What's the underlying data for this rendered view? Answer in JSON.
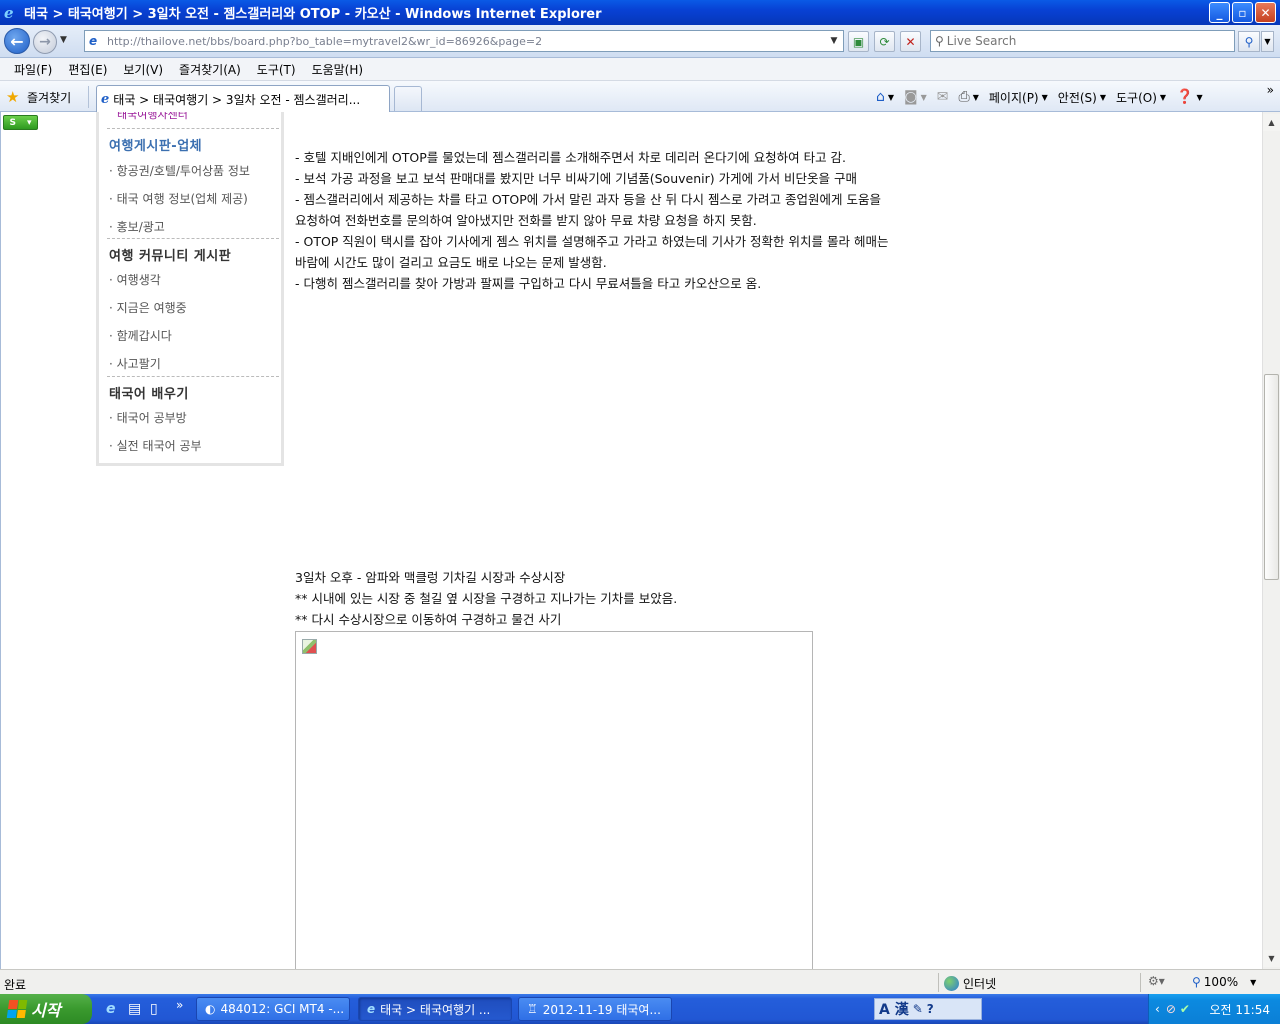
{
  "window": {
    "title": "태국 > 태국여행기 > 3일차 오전 - 젬스갤러리와 OTOP - 카오산 - Windows Internet Explorer",
    "logo_glyph": "e",
    "minimize": "_",
    "maximize": "▫",
    "close": "✕"
  },
  "address_bar": {
    "url": "http://thailove.net/bbs/board.php?bo_table=mytravel2&wr_id=86926&page=2",
    "search_placeholder": "Live Search"
  },
  "menu": [
    "파일(F)",
    "편집(E)",
    "보기(V)",
    "즐겨찾기(A)",
    "도구(T)",
    "도움말(H)"
  ],
  "tabs": {
    "favorites_label": "즐겨찾기",
    "active_tab": "태국 > 태국여행기 > 3일차 오전 - 젬스갤러리..."
  },
  "command_bar": {
    "page": "페이지(P)",
    "safety": "안전(S)",
    "tools": "도구(O)"
  },
  "sidebar": {
    "cut_top": "태국여행자센터",
    "sections": [
      {
        "heading": "여행게시판-업체",
        "items": [
          "· 항공권/호텔/투어상품 정보",
          "· 태국 여행 정보(업체 제공)",
          "· 홍보/광고"
        ]
      },
      {
        "heading": "여행 커뮤니티 게시판",
        "items": [
          "· 여행생각",
          "· 지금은 여행중",
          "· 함께갑시다",
          "· 사고팔기"
        ]
      },
      {
        "heading": "태국어 배우기",
        "items": [
          "· 태국어 공부방",
          "· 실전 태국어 공부"
        ]
      }
    ]
  },
  "article": {
    "paragraph1": [
      " - 호텔 지배인에게 OTOP를 물었는데 젬스갤러리를 소개해주면서 차로 데리러 온다기에 요청하여 타고 감.",
      " - 보석 가공 과정을 보고 보석 판매대를 봤지만 너무 비싸기에 기념품(Souvenir) 가게에 가서 비단옷을 구매",
      " - 젬스갤러리에서 제공하는 차를 타고 OTOP에 가서 말린 과자 등을 산 뒤 다시 젬스로 가려고 종업원에게 도움을",
      "요청하여 전화번호를 문의하여 알아냈지만 전화를 받지 않아 무료 차량 요청을 하지 못함.",
      " - OTOP 직원이 택시를 잡아 기사에게 젬스 위치를 설명해주고 가라고 하였는데 기사가 정확한 위치를 몰라 헤매는",
      "바람에 시간도 많이 걸리고 요금도 배로 나오는 문제 발생함.",
      " - 다행히 젬스갤러리를 찾아 가방과 팔찌를 구입하고 다시 무료셔틀을 타고 카오산으로 옴."
    ],
    "paragraph2": [
      "3일차 오후 - 암파와 맥클렁 기차길 시장과 수상시장",
      " ** 시내에 있는 시장 중 철길 옆 시장을 구경하고 지나가는 기차를 보았음.",
      " ** 다시 수상시장으로 이동하여 구경하고 물건 사기"
    ]
  },
  "status_bar": {
    "status": "완료",
    "zone": "인터넷",
    "zoom": "100%"
  },
  "taskbar": {
    "start": "시작",
    "tasks": [
      "484012: GCI MT4 -...",
      "태국 > 태국여행기 ...",
      "2012-11-19 태국여..."
    ],
    "lang": "A 漢",
    "clock": "오전 11:54"
  }
}
